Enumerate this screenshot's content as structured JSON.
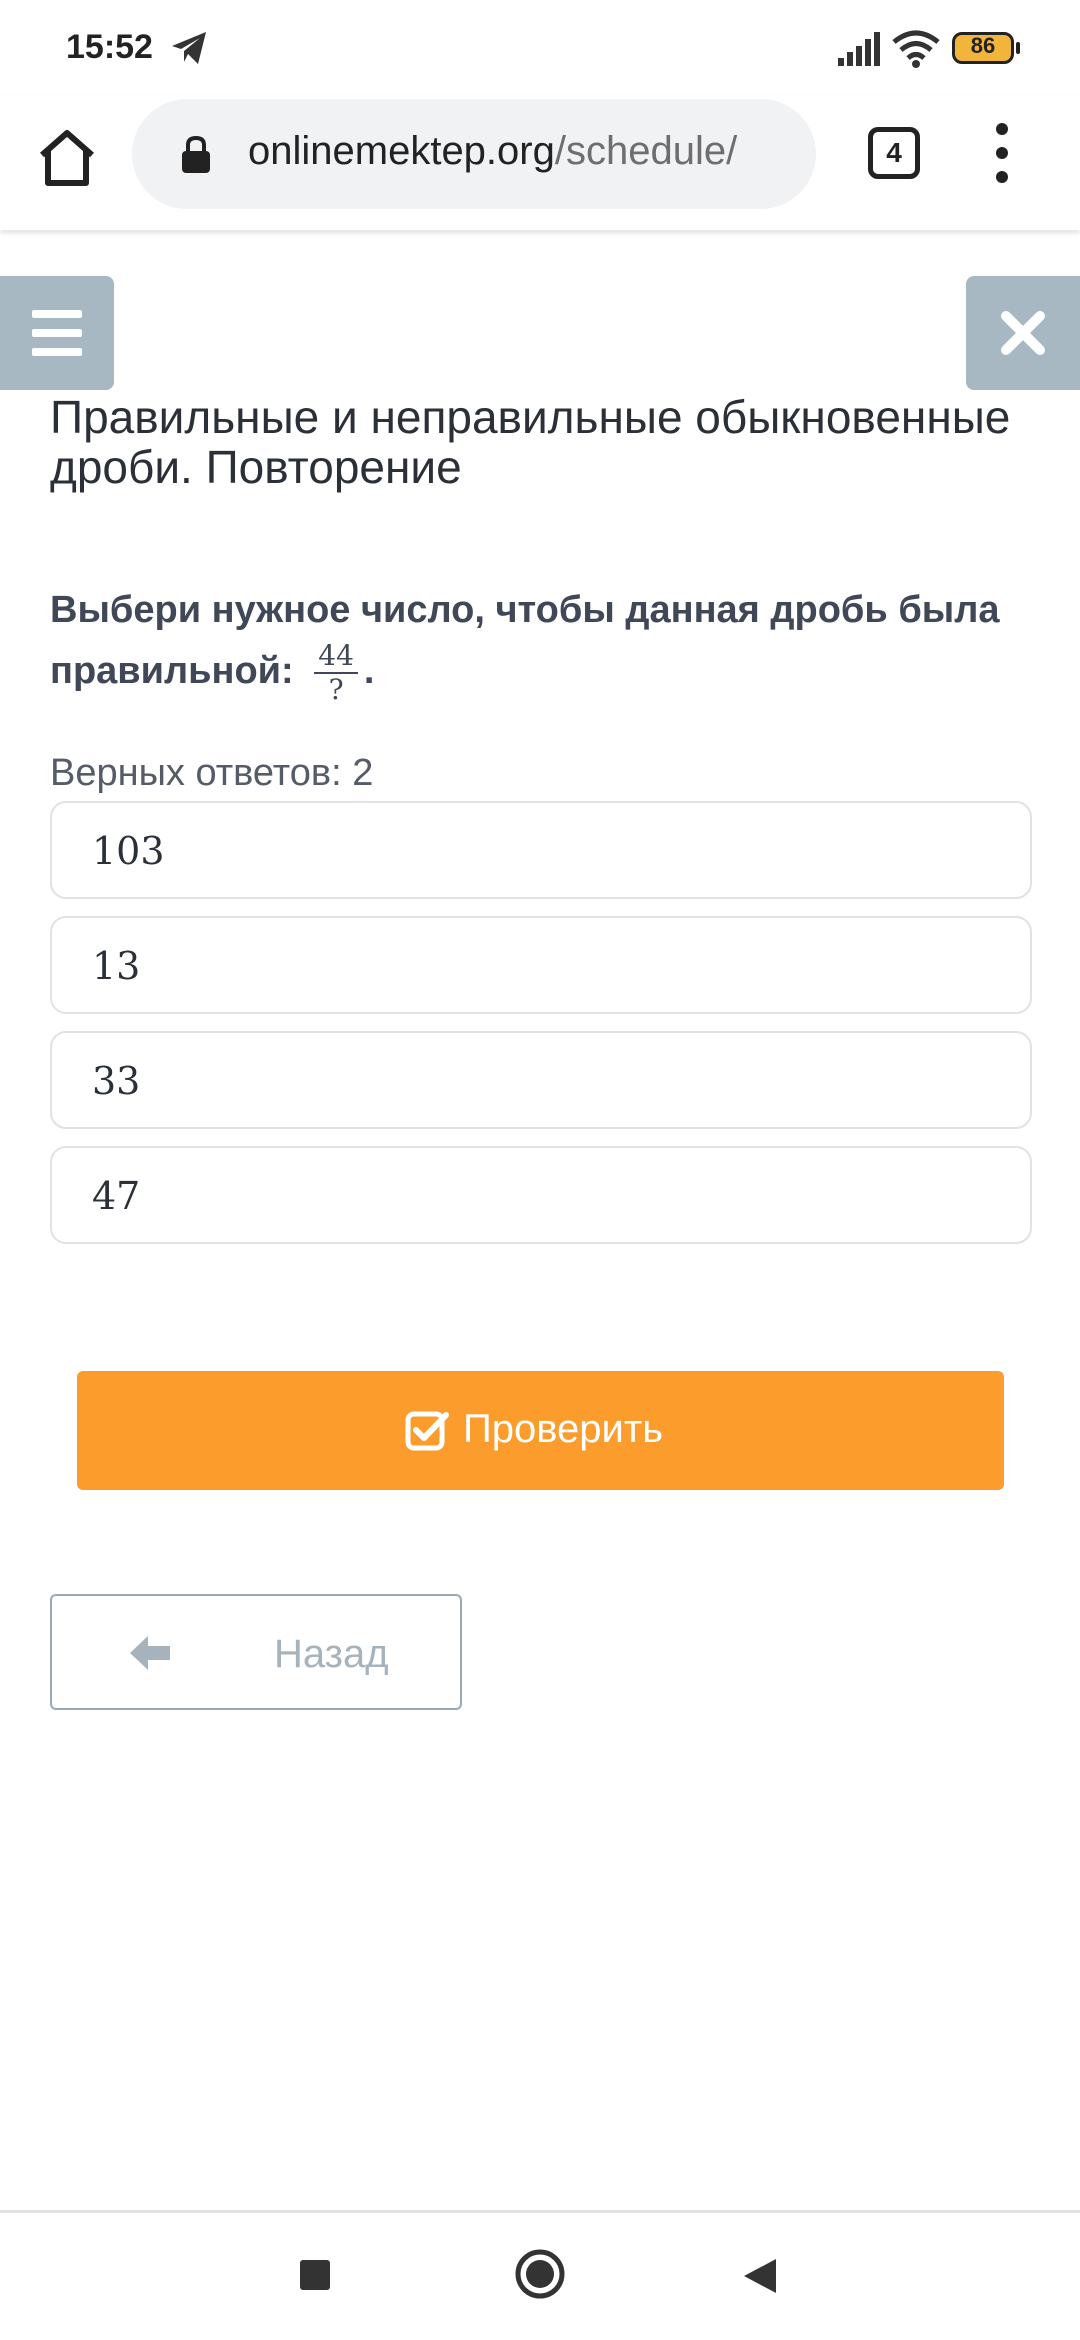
{
  "status_bar": {
    "time": "15:52",
    "battery": "86"
  },
  "browser": {
    "url_domain": "onlinemektep.org",
    "url_path": "/schedule/",
    "tab_count": "4"
  },
  "page": {
    "title": "Правильные и неправильные обыкновенные дроби. Повторение",
    "question_text": "Выбери нужное число, чтобы данная дробь была правильной:",
    "fraction_numerator": "44",
    "fraction_denominator": "?",
    "question_end": ".",
    "answers_count": "Верных ответов: 2",
    "options": [
      "103",
      "13",
      "33",
      "47"
    ],
    "check_button": "Проверить",
    "back_button": "Назад"
  },
  "colors": {
    "accent": "#fb9c2c",
    "overlay_button": "#a7b8c3",
    "back_border": "#9aa9b4"
  }
}
